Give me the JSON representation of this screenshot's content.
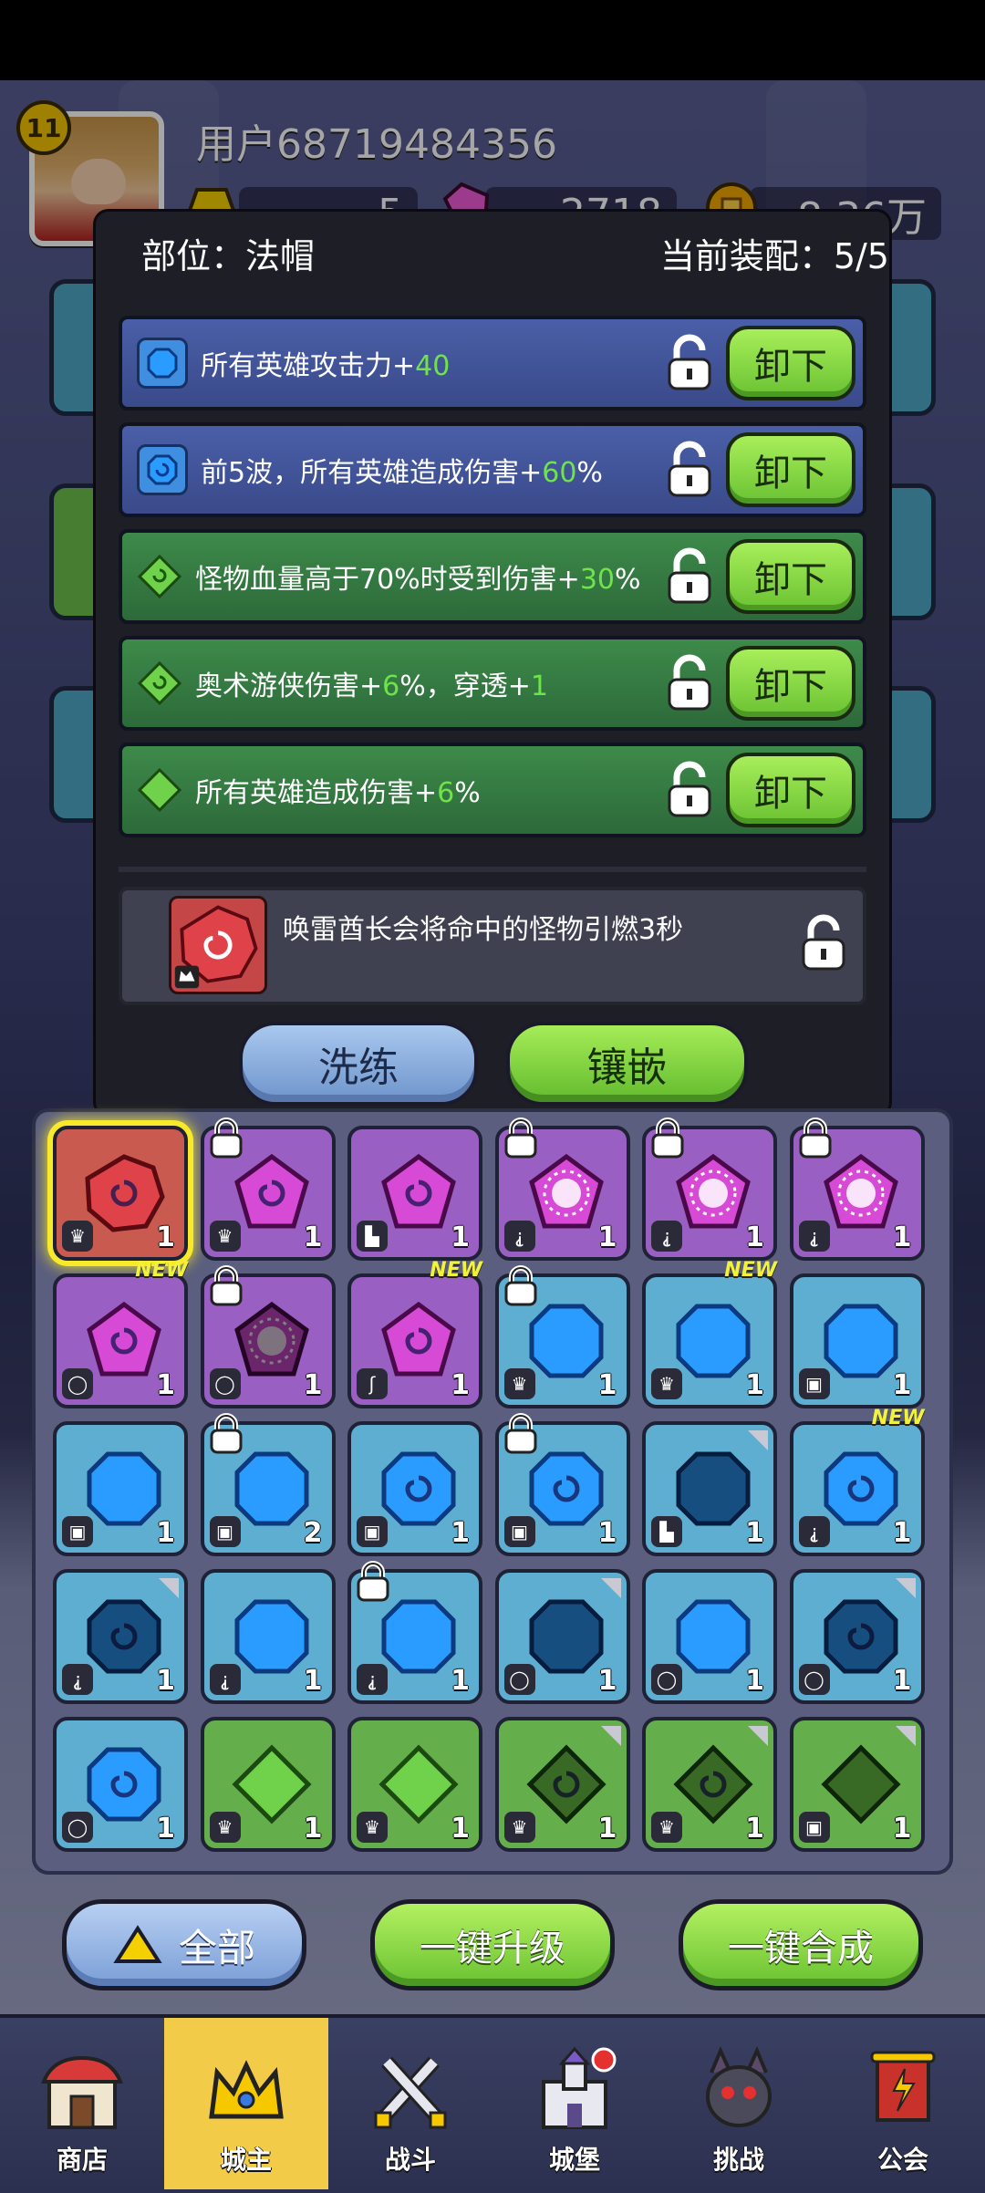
{
  "header": {
    "level": "11",
    "username": "用户68719484356",
    "resources": [
      {
        "name": "gold-bars",
        "icon": "gold-ingot-icon",
        "value": "5"
      },
      {
        "name": "gems",
        "icon": "pink-gem-icon",
        "value": "2718"
      },
      {
        "name": "coins",
        "icon": "coin-icon",
        "value": "8.36万"
      }
    ]
  },
  "modal": {
    "slot_label": "部位：法帽",
    "equip_count": "当前装配：5/5",
    "equipped": [
      {
        "prefix": "所有英雄攻击力+",
        "value": "40",
        "suffix": "",
        "color": "blue",
        "unload": "卸下"
      },
      {
        "prefix": "前5波，所有英雄造成伤害+",
        "value": "60",
        "suffix": "%",
        "color": "blue",
        "unload": "卸下"
      },
      {
        "prefix": "怪物血量高于70%时受到伤害+",
        "value": "30",
        "suffix": "%",
        "color": "green",
        "unload": "卸下"
      },
      {
        "prefix": "奥术游侠伤害+",
        "value": "6",
        "suffix": "%，穿透+",
        "value2": "1",
        "color": "green",
        "unload": "卸下"
      },
      {
        "prefix": "所有英雄造成伤害+",
        "value": "6",
        "suffix": "%",
        "color": "green",
        "unload": "卸下"
      }
    ],
    "rune_description": "唤雷酋长会将命中的怪物引燃3秒",
    "refine_label": "洗练",
    "inlay_label": "镶嵌"
  },
  "inventory": {
    "cells": [
      {
        "color": "red",
        "count": "1",
        "type": "crown",
        "selected": true
      },
      {
        "color": "purple",
        "count": "1",
        "type": "crown",
        "locked": true
      },
      {
        "color": "purple",
        "count": "1",
        "type": "boot"
      },
      {
        "color": "purple",
        "count": "1",
        "type": "staff",
        "locked": true,
        "sun": true
      },
      {
        "color": "purple",
        "count": "1",
        "type": "staff",
        "locked": true,
        "sun": true
      },
      {
        "color": "purple",
        "count": "1",
        "type": "staff",
        "locked": true,
        "sun": true
      },
      {
        "color": "purple",
        "count": "1",
        "type": "ring",
        "new": true
      },
      {
        "color": "purple",
        "count": "1",
        "type": "ring",
        "locked": true,
        "dark": true,
        "sun": true
      },
      {
        "color": "purple",
        "count": "1",
        "type": "hook",
        "new": true
      },
      {
        "color": "blue",
        "count": "1",
        "type": "crown",
        "locked": true
      },
      {
        "color": "blue",
        "count": "1",
        "type": "crown",
        "new": true
      },
      {
        "color": "blue",
        "count": "1",
        "type": "shirt"
      },
      {
        "color": "blue",
        "count": "1",
        "type": "shirt"
      },
      {
        "color": "blue",
        "count": "2",
        "type": "shirt",
        "locked": true
      },
      {
        "color": "blue",
        "count": "1",
        "type": "shirt",
        "swirl": true
      },
      {
        "color": "blue",
        "count": "1",
        "type": "shirt",
        "locked": true,
        "swirl": true
      },
      {
        "color": "blue",
        "count": "1",
        "type": "boot",
        "dark": true,
        "corner": true
      },
      {
        "color": "blue",
        "count": "1",
        "type": "staff",
        "swirl": true,
        "new": true
      },
      {
        "color": "blue",
        "count": "1",
        "type": "staff",
        "dark": true,
        "corner": true,
        "swirl": true
      },
      {
        "color": "blue",
        "count": "1",
        "type": "staff"
      },
      {
        "color": "blue",
        "count": "1",
        "type": "staff",
        "locked": true
      },
      {
        "color": "blue",
        "count": "1",
        "type": "ring",
        "dark": true,
        "corner": true
      },
      {
        "color": "blue",
        "count": "1",
        "type": "ring"
      },
      {
        "color": "blue",
        "count": "1",
        "type": "ring",
        "dark": true,
        "corner": true,
        "swirl": true
      },
      {
        "color": "blue",
        "count": "1",
        "type": "ring",
        "swirl": true
      },
      {
        "color": "green",
        "count": "1",
        "type": "crown"
      },
      {
        "color": "green",
        "count": "1",
        "type": "crown"
      },
      {
        "color": "green",
        "count": "1",
        "type": "crown",
        "dark": true,
        "corner": true,
        "swirl": true
      },
      {
        "color": "green",
        "count": "1",
        "type": "crown",
        "dark": true,
        "corner": true,
        "swirl": true
      },
      {
        "color": "green",
        "count": "1",
        "type": "shirt",
        "dark": true,
        "corner": true
      }
    ]
  },
  "actions": {
    "all_label": "全部",
    "upgrade_label": "一键升级",
    "merge_label": "一键合成"
  },
  "nav": [
    {
      "label": "商店",
      "icon": "shop-icon",
      "active": false
    },
    {
      "label": "城主",
      "icon": "crown-icon",
      "active": true
    },
    {
      "label": "战斗",
      "icon": "crossed-swords-icon",
      "active": false
    },
    {
      "label": "城堡",
      "icon": "castle-icon",
      "active": false
    },
    {
      "label": "挑战",
      "icon": "demon-icon",
      "active": false
    },
    {
      "label": "公会",
      "icon": "guild-banner-icon",
      "active": false
    }
  ],
  "colors": {
    "accent_green": "#6fe34a",
    "button_green": "#6ac232",
    "selection_yellow": "#f8ea2a",
    "nav_active": "#f2cc48"
  }
}
